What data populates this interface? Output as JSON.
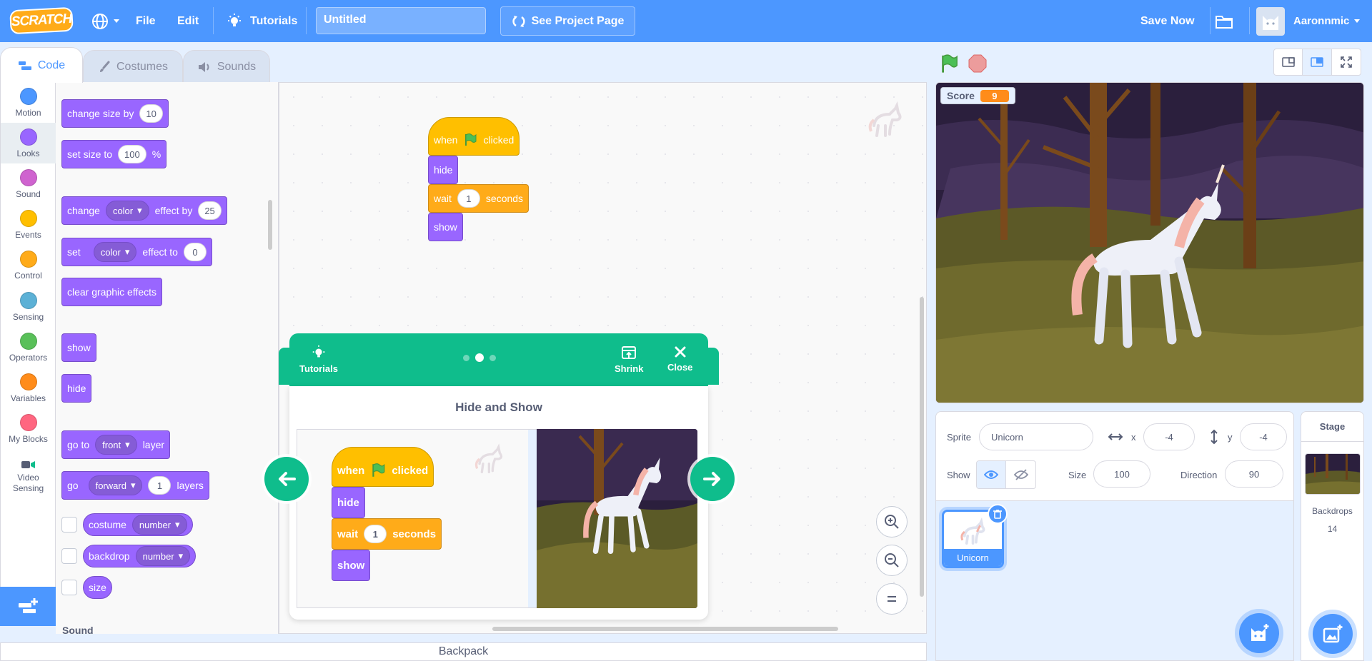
{
  "menubar": {
    "logo": "SCRATCH",
    "file": "File",
    "edit": "Edit",
    "tutorials": "Tutorials",
    "project_title": "Untitled",
    "see_project": "See Project Page",
    "save_now": "Save Now",
    "username": "Aaronnmic"
  },
  "tabs": {
    "code": "Code",
    "costumes": "Costumes",
    "sounds": "Sounds"
  },
  "categories": [
    {
      "label": "Motion",
      "color": "#4c97ff"
    },
    {
      "label": "Looks",
      "color": "#9966ff"
    },
    {
      "label": "Sound",
      "color": "#cf63cf"
    },
    {
      "label": "Events",
      "color": "#ffbf00"
    },
    {
      "label": "Control",
      "color": "#ffab19"
    },
    {
      "label": "Sensing",
      "color": "#5cb1d6"
    },
    {
      "label": "Operators",
      "color": "#59c059"
    },
    {
      "label": "Variables",
      "color": "#ff8c1a"
    },
    {
      "label": "My Blocks",
      "color": "#ff6680"
    },
    {
      "label": "Video Sensing",
      "color": "#0fbd8c"
    }
  ],
  "palette": {
    "change_size": {
      "t1": "change size by",
      "v": "10"
    },
    "set_size": {
      "t1": "set size to",
      "v": "100",
      "t2": "%"
    },
    "change_effect": {
      "t1": "change",
      "dd": "color",
      "t2": "effect by",
      "v": "25"
    },
    "set_effect": {
      "t1": "set",
      "dd": "color",
      "t2": "effect to",
      "v": "0"
    },
    "clear_effects": "clear graphic effects",
    "show": "show",
    "hide": "hide",
    "go_to_layer": {
      "t1": "go to",
      "dd": "front",
      "t2": "layer"
    },
    "go_layers": {
      "t1": "go",
      "dd": "forward",
      "v": "1",
      "t2": "layers"
    },
    "costume": {
      "t1": "costume",
      "dd": "number"
    },
    "backdrop": {
      "t1": "backdrop",
      "dd": "number"
    },
    "size": "size",
    "next_section": "Sound"
  },
  "script": {
    "when": "when",
    "clicked": "clicked",
    "hide": "hide",
    "wait": "wait",
    "wait_val": "1",
    "seconds": "seconds",
    "show": "show"
  },
  "tutorial": {
    "label": "Tutorials",
    "shrink": "Shrink",
    "close": "Close",
    "title": "Hide and Show",
    "steps": 3,
    "current_step": 2
  },
  "backpack": "Backpack",
  "stage": {
    "monitor_label": "Score",
    "monitor_value": "9"
  },
  "sprite_info": {
    "sprite_label": "Sprite",
    "sprite_name": "Unicorn",
    "x_label": "x",
    "x": "-4",
    "y_label": "y",
    "y": "-4",
    "show_label": "Show",
    "size_label": "Size",
    "size": "100",
    "direction_label": "Direction",
    "direction": "90"
  },
  "sprites": [
    {
      "name": "Unicorn"
    }
  ],
  "stage_pane": {
    "title": "Stage",
    "backdrops_label": "Backdrops",
    "backdrops_count": "14"
  }
}
